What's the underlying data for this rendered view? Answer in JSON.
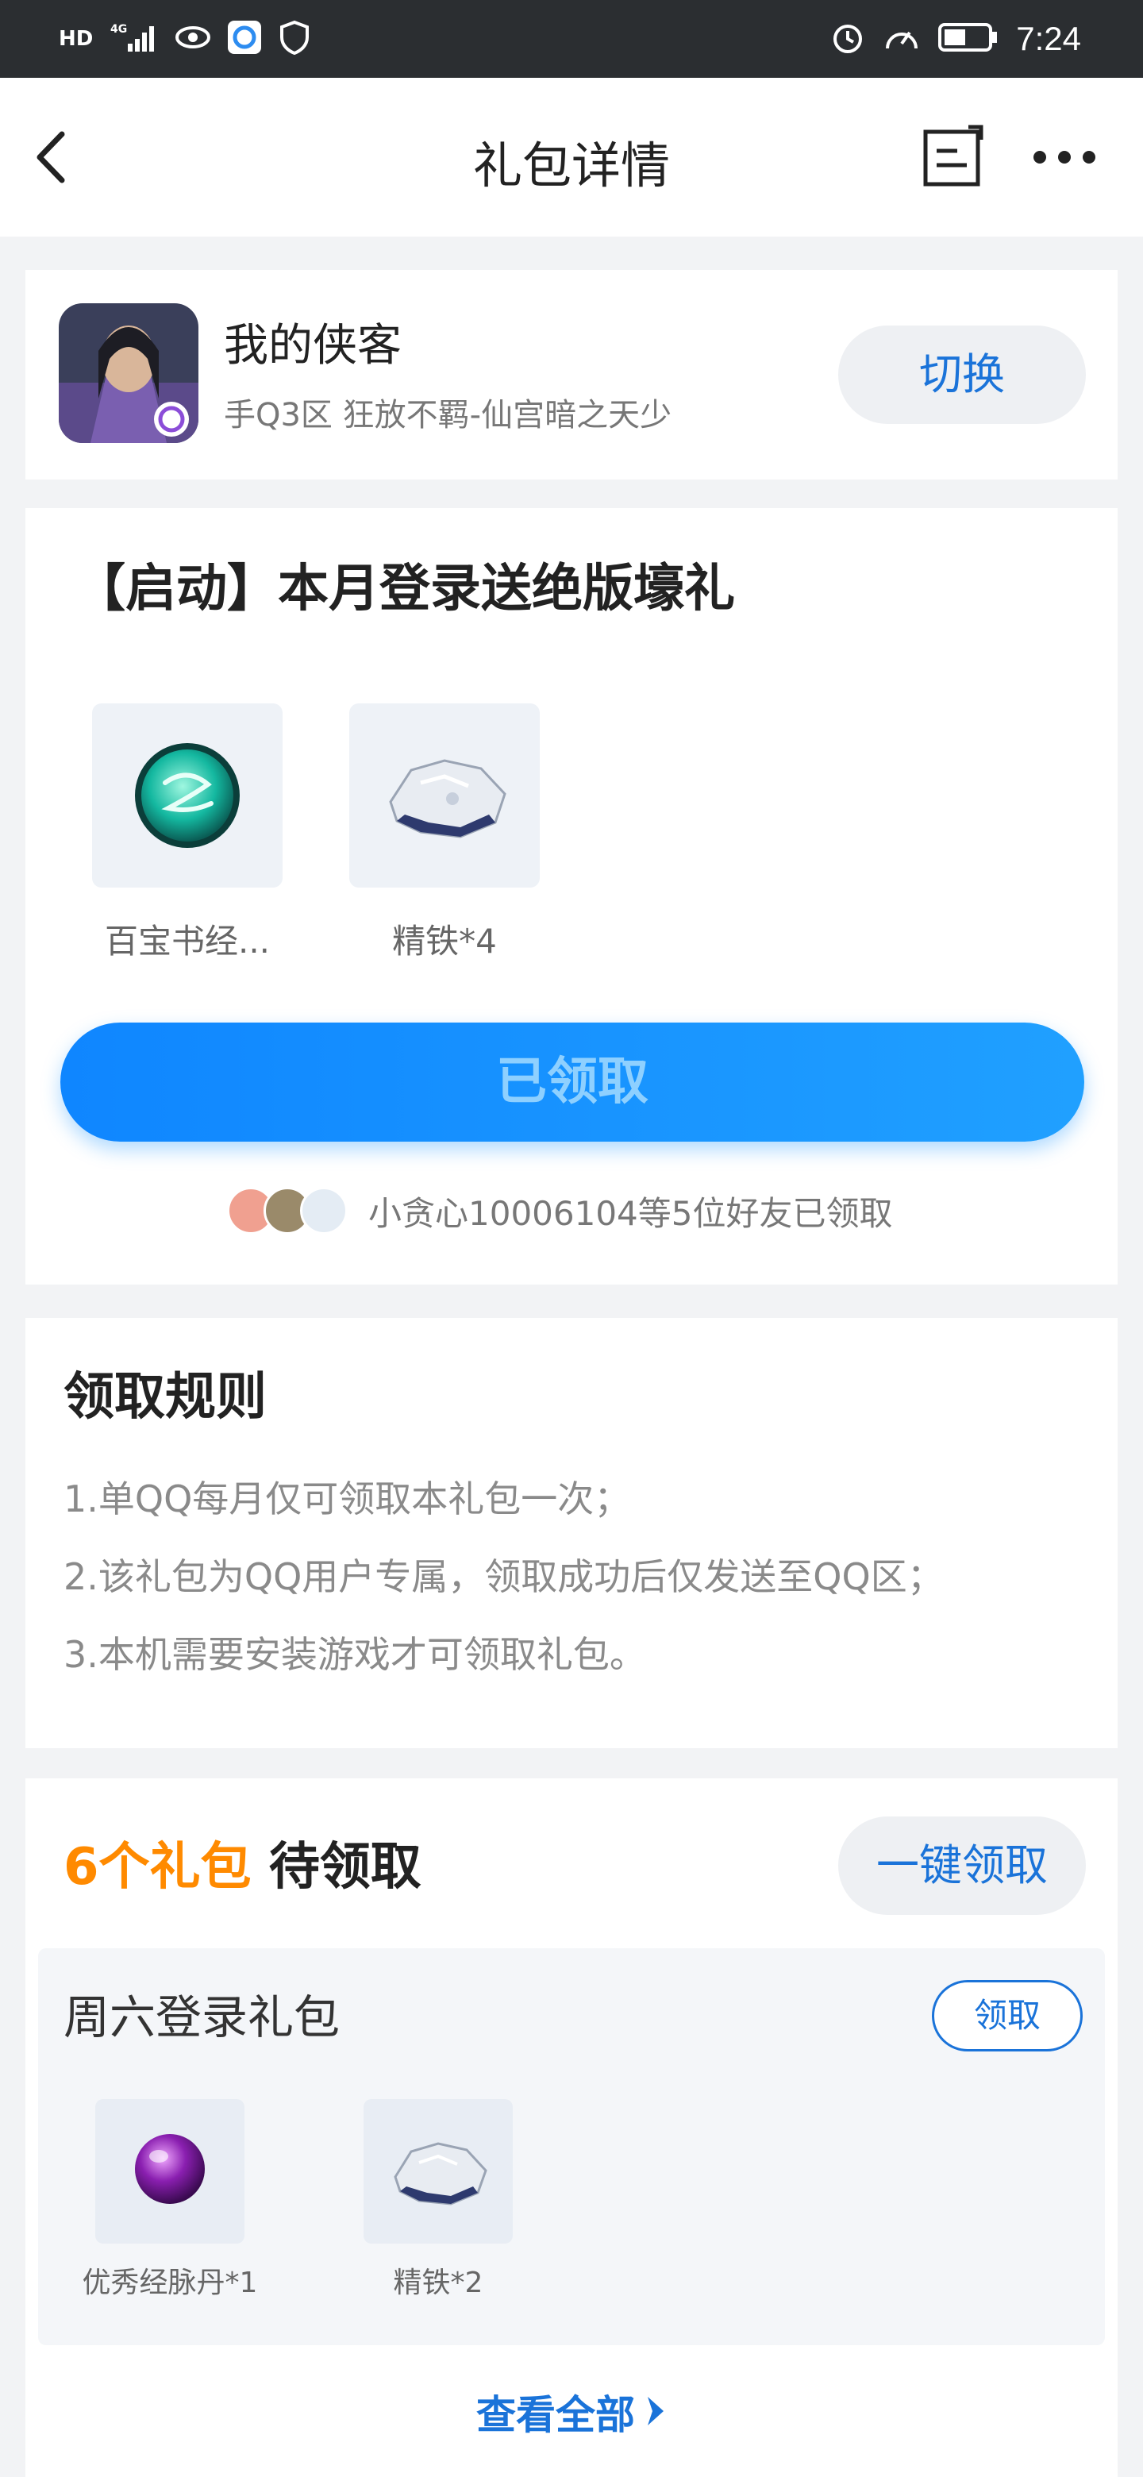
{
  "status_bar": {
    "left_labels": [
      "HD",
      "4G"
    ],
    "time": "7:24"
  },
  "header": {
    "title": "礼包详情"
  },
  "game": {
    "name": "我的侠客",
    "zone": "手Q3区 狂放不羁-仙宫暗之天少",
    "switch_label": "切换"
  },
  "gift": {
    "title": "【启动】本月登录送绝版壕礼",
    "items": [
      {
        "label": "百宝书经...",
        "icon": "jade-orb-icon"
      },
      {
        "label": "精铁*4",
        "icon": "iron-ore-icon"
      }
    ],
    "button_label": "已领取",
    "friends_text": "小贪心10006104等5位好友已领取"
  },
  "rules": {
    "title": "领取规则",
    "items": [
      "1.单QQ每月仅可领取本礼包一次；",
      "2.该礼包为QQ用户专属，领取成功后仅发送至QQ区；",
      "3.本机需要安装游戏才可领取礼包。"
    ]
  },
  "pending": {
    "count_label": "6个礼包",
    "suffix_label": " 待领取",
    "onekey_label": "一键领取",
    "pack": {
      "name": "周六登录礼包",
      "claim_label": "领取",
      "items": [
        {
          "label": "优秀经脉丹*1",
          "icon": "purple-pill-icon"
        },
        {
          "label": "精铁*2",
          "icon": "iron-ore-icon"
        }
      ]
    },
    "view_all_label": "查看全部"
  },
  "colors": {
    "accent_blue": "#1a73d9",
    "button_blue": "#0f86ff",
    "orange": "#ff8a00"
  }
}
